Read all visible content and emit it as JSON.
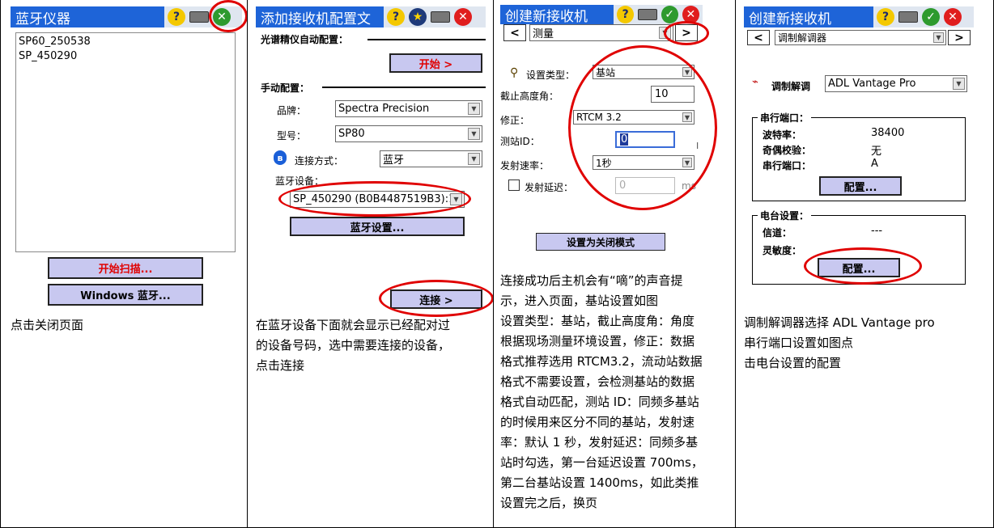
{
  "screens": {
    "s1": {
      "title": "蓝牙仪器",
      "devices": [
        "SP60_250538",
        "SP_450290"
      ],
      "scan_button": "开始扫描...",
      "windows_bt_button": "Windows 蓝牙...",
      "caption": "点击关闭页面"
    },
    "s2": {
      "title": "添加接收机配置文",
      "auto_section": "光谱精仪自动配置：",
      "start_button": "开始 >",
      "manual_section": "手动配置：",
      "brand_label": "品牌：",
      "brand_value": "Spectra Precision",
      "model_label": "型号：",
      "model_value": "SP80",
      "conn_label": "连接方式：",
      "conn_value": "蓝牙",
      "bt_device_label": "蓝牙设备：",
      "bt_device_value": "SP_450290 (B0B4487519B3):1",
      "bt_settings_button": "蓝牙设置...",
      "connect_button": "连接 >",
      "caption": [
        "在蓝牙设备下面就会显示已经配对过",
        "的设备号码，选中需要连接的设备，",
        "点击连接"
      ]
    },
    "s3": {
      "title": "创建新接收机",
      "prev": "<",
      "next": ">",
      "mode_value": "测量",
      "type_label": "设置类型：",
      "type_value": "基站",
      "cutoff_label": "截止高度角：",
      "cutoff_value": "10",
      "correction_label": "修正：",
      "correction_value": "RTCM 3.2",
      "station_id_label": "测站ID：",
      "station_id_value": "0",
      "rate_label": "发射速率：",
      "rate_value": "1秒",
      "delay_label": "发射延迟：",
      "delay_value": "0",
      "delay_unit": "ms",
      "close_mode_button": "设置为关闭模式",
      "caption": [
        "连接成功后主机会有“嘀”的声音提",
        "示，进入页面，基站设置如图",
        "设置类型：基站，截止高度角：角度",
        "根据现场测量环境设置，修正：数据",
        "格式推荐选用 RTCM3.2，流动站数据",
        "格式不需要设置，会检测基站的数据",
        "格式自动匹配，测站 ID：同频多基站",
        "的时候用来区分不同的基站，发射速",
        "率：默认 1 秒，发射延迟：同频多基",
        "站时勾选，第一台延迟设置 700ms，",
        "第二台基站设置 1400ms，如此类推",
        "设置完之后，换页"
      ]
    },
    "s4": {
      "title": "创建新接收机",
      "prev": "<",
      "next": ">",
      "page_value": "调制解调器",
      "modem_label": "调制解调",
      "modem_value": "ADL Vantage Pro",
      "serial_group": "串行端口：",
      "baud_label": "波特率：",
      "baud_value": "38400",
      "parity_label": "奇偶校验：",
      "parity_value": "无",
      "port_label": "串行端口：",
      "port_value": "A",
      "config_button": "配置...",
      "radio_group": "电台设置：",
      "channel_label": "信道：",
      "channel_value": "---",
      "sensitivity_label": "灵敏度：",
      "radio_config_button": "配置...",
      "caption": [
        "调制解调器选择  ADL Vantage pro",
        "串行端口设置如图点",
        "击电台设置的配置"
      ]
    }
  },
  "colors": {
    "titlebar": "#1e64d8",
    "button_fill": "#c8c8f0",
    "highlight_oval": "#e00000"
  }
}
